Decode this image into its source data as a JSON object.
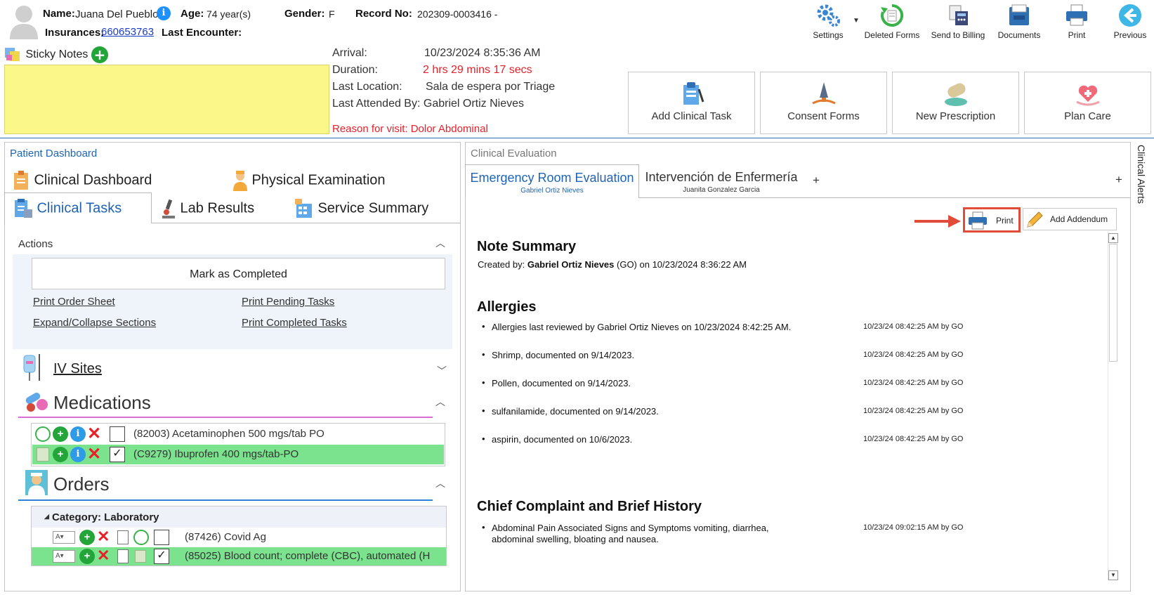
{
  "patient": {
    "name_label": "Name:",
    "name": "Juana Del Pueblo",
    "age_label": "Age:",
    "age": "74 year(s)",
    "gender_label": "Gender:",
    "gender": "F",
    "record_label": "Record No:",
    "record": "202309-0003416 -",
    "insurances_label": "Insurances:",
    "insurances": "660653763",
    "last_encounter_label": "Last Encounter:"
  },
  "toolbar": [
    {
      "label": "Settings",
      "icon": "gear-icon"
    },
    {
      "label": "Deleted Forms",
      "icon": "restore-icon"
    },
    {
      "label": "Send to Billing",
      "icon": "billing-icon"
    },
    {
      "label": "Documents",
      "icon": "documents-icon"
    },
    {
      "label": "Print",
      "icon": "printer-icon"
    },
    {
      "label": "Previous",
      "icon": "back-arrow-icon"
    }
  ],
  "sticky": {
    "label": "Sticky Notes"
  },
  "visit": {
    "arrival_label": "Arrival:",
    "arrival": "10/23/2024 8:35:36 AM",
    "duration_label": "Duration:",
    "duration": "2 hrs 29 mins 17 secs",
    "location_label": "Last Location:",
    "location": "Sala de espera por Triage",
    "attended": "Last Attended By: Gabriel Ortiz Nieves",
    "reason": "Reason for visit: Dolor Abdominal"
  },
  "quick_actions": [
    {
      "label": "Add Clinical Task"
    },
    {
      "label": "Consent Forms"
    },
    {
      "label": "New Prescription"
    },
    {
      "label": "Plan Care"
    }
  ],
  "left": {
    "title": "Patient Dashboard",
    "tabs": {
      "clinical_dashboard": "Clinical Dashboard",
      "physical_exam": "Physical Examination",
      "clinical_tasks": "Clinical Tasks",
      "lab_results": "Lab Results",
      "service_summary": "Service Summary"
    },
    "actions": {
      "title": "Actions",
      "mark_completed": "Mark as Completed",
      "print_order_sheet": "Print Order Sheet",
      "print_pending": "Print Pending Tasks",
      "expand_collapse": "Expand/Collapse Sections",
      "print_completed": "Print Completed Tasks"
    },
    "iv_sites": "IV Sites",
    "medications": {
      "title": "Medications",
      "items": [
        {
          "text": "(82003) Acetaminophen 500 mgs/tab PO",
          "checked": ""
        },
        {
          "text": "(C9279) Ibuprofen 400 mgs/tab-PO",
          "checked": "✓"
        }
      ]
    },
    "orders": {
      "title": "Orders",
      "category": "Category: Laboratory",
      "items": [
        {
          "text": "(87426) Covid Ag",
          "checked": ""
        },
        {
          "text": "(85025) Blood count; complete (CBC), automated (H",
          "checked": "✓"
        }
      ]
    }
  },
  "right": {
    "title": "Clinical Evaluation",
    "tabs": [
      {
        "label": "Emergency Room Evaluation",
        "sub": "Gabriel Ortiz Nieves"
      },
      {
        "label": "Intervención de Enfermería",
        "sub": "Juanita Gonzalez Garcia"
      }
    ],
    "add_tab": "+",
    "add_tab_far": "+",
    "print": "Print",
    "addendum": "Add Addendum",
    "note_summary": {
      "title": "Note Summary",
      "created_prefix": "Created by: ",
      "created_by": "Gabriel Ortiz Nieves",
      "created_suffix": "  (GO) on 10/23/2024 8:36:22 AM"
    },
    "allergies": {
      "title": "Allergies",
      "items": [
        {
          "text": "Allergies last reviewed by Gabriel Ortiz Nieves on 10/23/2024 8:42:25 AM.",
          "stamp": "10/23/24 08:42:25 AM by GO"
        },
        {
          "text": "Shrimp, documented on 9/14/2023.",
          "stamp": "10/23/24 08:42:25 AM by GO"
        },
        {
          "text": "Pollen, documented on 9/14/2023.",
          "stamp": "10/23/24 08:42:25 AM by GO"
        },
        {
          "text": "sulfanilamide, documented on 9/14/2023.",
          "stamp": "10/23/24 08:42:25 AM by GO"
        },
        {
          "text": "aspirin, documented on 10/6/2023.",
          "stamp": "10/23/24 08:42:25 AM by GO"
        }
      ]
    },
    "complaint": {
      "title": "Chief Complaint and Brief History",
      "line1": "Abdominal Pain Associated Signs and Symptoms vomiting, diarrhea,",
      "line2": "abdominal swelling, bloating and nausea.",
      "stamp": "10/23/24 09:02:15 AM by GO"
    }
  },
  "alerts": {
    "label": "Clinical Alerts"
  },
  "colors": {
    "accent_blue": "#1f64b4",
    "sticky_yellow": "#fbf788",
    "selected_green": "#7be28e",
    "alert_red": "#e8202a",
    "highlight_red": "#e04b3a"
  }
}
